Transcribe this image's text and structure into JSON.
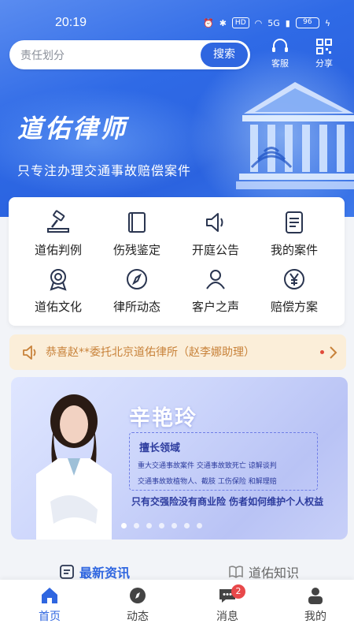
{
  "status_bar": {
    "time": "20:19",
    "network": "HD",
    "signal": "5G",
    "battery": "96"
  },
  "search": {
    "placeholder": "责任划分",
    "button": "搜索"
  },
  "top_actions": [
    {
      "label": "客服",
      "icon": "headset-icon"
    },
    {
      "label": "分享",
      "icon": "qr-code-icon"
    }
  ],
  "brand": {
    "title": "道佑律师",
    "subtitle": "只专注办理交通事故赔偿案件"
  },
  "grid": [
    {
      "label": "道佑判例",
      "icon": "gavel-icon"
    },
    {
      "label": "伤残鉴定",
      "icon": "book-icon"
    },
    {
      "label": "开庭公告",
      "icon": "speaker-icon"
    },
    {
      "label": "我的案件",
      "icon": "document-icon"
    },
    {
      "label": "道佑文化",
      "icon": "award-icon"
    },
    {
      "label": "律所动态",
      "icon": "compass-icon"
    },
    {
      "label": "客户之声",
      "icon": "user-icon"
    },
    {
      "label": "赔偿方案",
      "icon": "yen-icon"
    }
  ],
  "notice": {
    "text": "恭喜赵**委托北京道佑律所（赵李娜助理）",
    "icon": "speaker-icon"
  },
  "banner": {
    "name": "辛艳玲",
    "specialty_title": "擅长领域",
    "specialties_row1": "重大交通事故案件    交通事故致死亡    谅解谈判",
    "specialties_row2": "交通事故致植物人、截肢    工伤保险    和解理赔",
    "slogan": "只有交强险没有商业险 伤者如何维护个人权益",
    "slide_count": 7,
    "active_slide": 0
  },
  "sections": [
    {
      "label": "最新资讯",
      "icon": "news-icon"
    },
    {
      "label": "道佑知识",
      "icon": "book-open-icon"
    }
  ],
  "tabbar": [
    {
      "label": "首页",
      "icon": "home-icon",
      "active": true
    },
    {
      "label": "动态",
      "icon": "compass-icon"
    },
    {
      "label": "消息",
      "icon": "chat-icon",
      "badge": "2"
    },
    {
      "label": "我的",
      "icon": "profile-icon"
    }
  ],
  "colors": {
    "primary": "#2f66e0",
    "notice_bg": "#fbeed9",
    "notice_text": "#c8823a",
    "badge": "#e8484a"
  }
}
